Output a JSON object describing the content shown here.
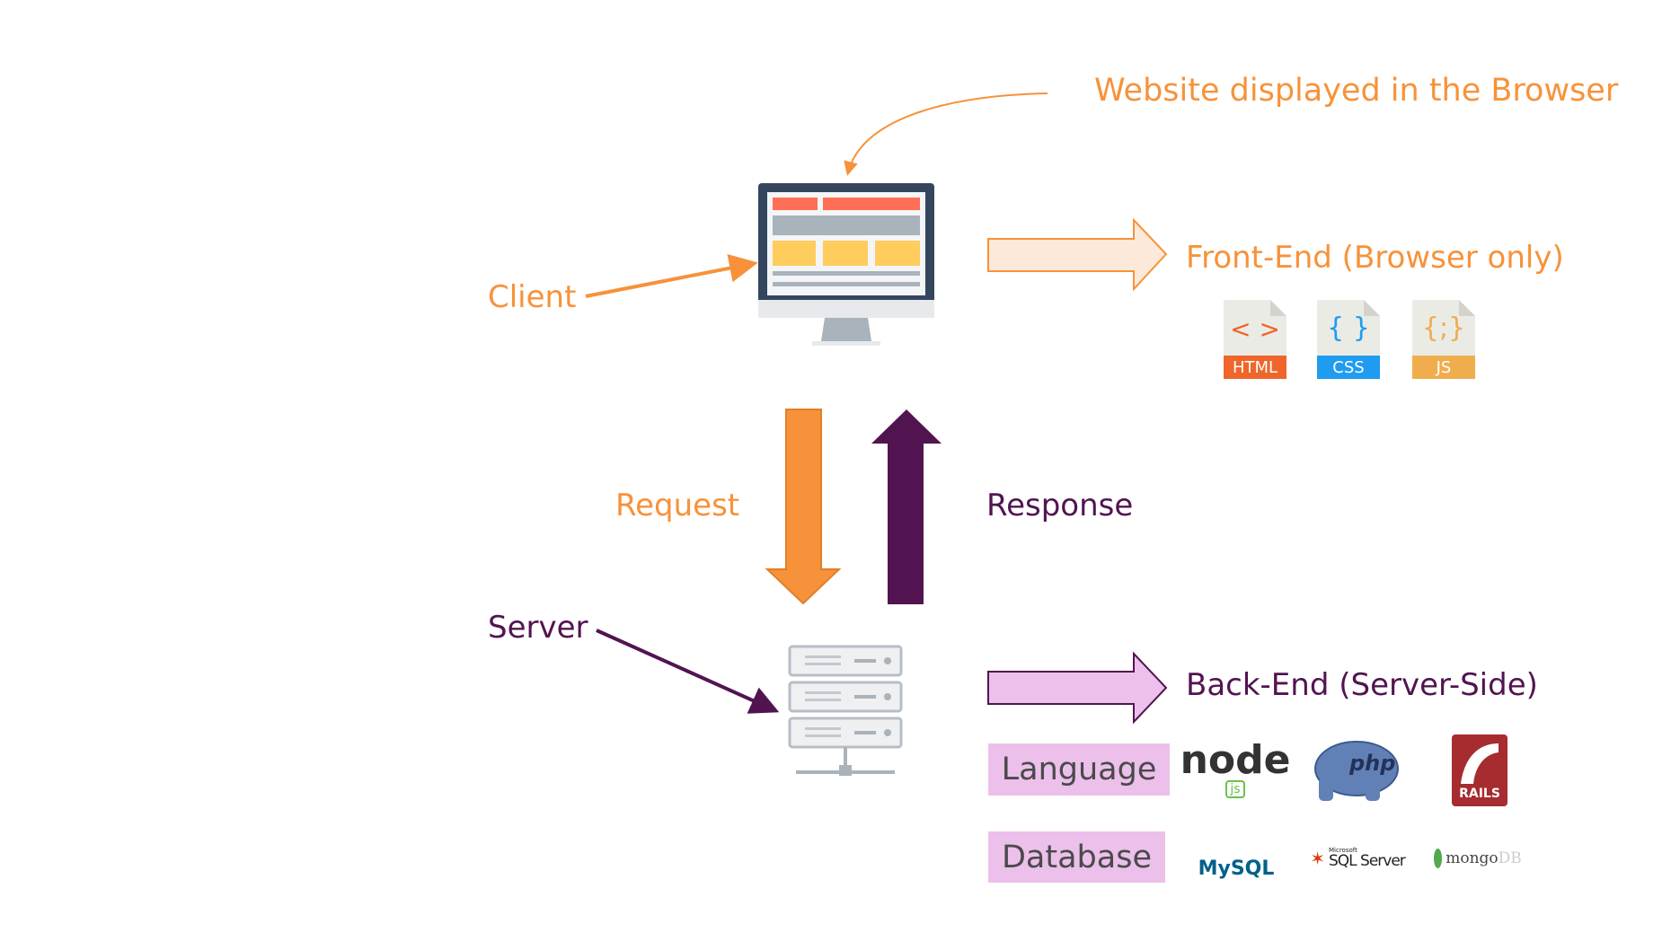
{
  "labels": {
    "website": "Website displayed in the Browser",
    "client": "Client",
    "server": "Server",
    "request": "Request",
    "response": "Response",
    "frontend": "Front-End (Browser only)",
    "backend": "Back-End (Server-Side)",
    "language": "Language",
    "database": "Database"
  },
  "frontend_files": [
    {
      "name": "HTML",
      "glyph": "< >",
      "color": "#ef652a"
    },
    {
      "name": "CSS",
      "glyph": "{ }",
      "color": "#1f9cf0"
    },
    {
      "name": "JS",
      "glyph": "{;}",
      "color": "#f0ad4e"
    }
  ],
  "language_logos": [
    "node",
    "js",
    "php",
    "RAILS"
  ],
  "database_logos": {
    "mysql": "MySQL",
    "sqlserver_small": "Microsoft",
    "sqlserver": "SQL Server",
    "mongo": "mongo",
    "mongo_db": "DB"
  },
  "colors": {
    "orange": "#f7923a",
    "purple": "#521450",
    "pink": "#ecc0ea",
    "peach": "#fde9da"
  }
}
